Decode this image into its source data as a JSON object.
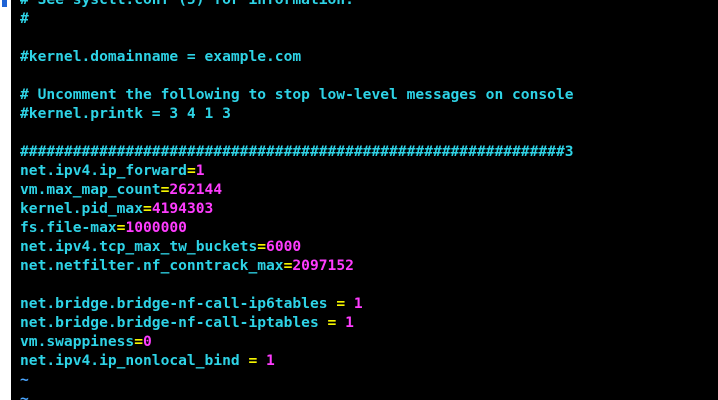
{
  "editor": {
    "lines": [
      {
        "type": "comment",
        "text": "# See sysctl.conf (5) for information."
      },
      {
        "type": "comment",
        "text": "#"
      },
      {
        "type": "blank"
      },
      {
        "type": "comment",
        "text": "#kernel.domainname = example.com"
      },
      {
        "type": "blank"
      },
      {
        "type": "comment",
        "text": "# Uncomment the following to stop low-level messages on console"
      },
      {
        "type": "comment",
        "text": "#kernel.printk = 3 4 1 3"
      },
      {
        "type": "blank"
      },
      {
        "type": "comment",
        "text": "##############################################################3"
      },
      {
        "type": "setting",
        "key": "net.ipv4.ip_forward",
        "eq": "=",
        "value": "1"
      },
      {
        "type": "setting",
        "key": "vm.max_map_count",
        "eq": "=",
        "value": "262144"
      },
      {
        "type": "setting",
        "key": "kernel.pid_max",
        "eq": "=",
        "value": "4194303"
      },
      {
        "type": "setting",
        "key": "fs.file-max",
        "eq": "=",
        "value": "1000000"
      },
      {
        "type": "setting",
        "key": "net.ipv4.tcp_max_tw_buckets",
        "eq": "=",
        "value": "6000"
      },
      {
        "type": "setting",
        "key": "net.netfilter.nf_conntrack_max",
        "eq": "=",
        "value": "2097152"
      },
      {
        "type": "blank"
      },
      {
        "type": "setting",
        "key": "net.bridge.bridge-nf-call-ip6tables",
        "eq": " = ",
        "value": "1"
      },
      {
        "type": "setting",
        "key": "net.bridge.bridge-nf-call-iptables",
        "eq": " = ",
        "value": "1"
      },
      {
        "type": "setting",
        "key": "vm.swappiness",
        "eq": "=",
        "value": "0"
      },
      {
        "type": "setting",
        "key": "net.ipv4.ip_nonlocal_bind",
        "eq": " = ",
        "value": "1"
      },
      {
        "type": "tilde",
        "text": "~"
      },
      {
        "type": "tilde",
        "text": "~"
      }
    ]
  },
  "colors": {
    "background": "#000000",
    "comment": "#2ed3e6",
    "key": "#2ed3e6",
    "equals": "#f5f500",
    "value": "#ff3cff",
    "tilde": "#4aa6ff"
  }
}
